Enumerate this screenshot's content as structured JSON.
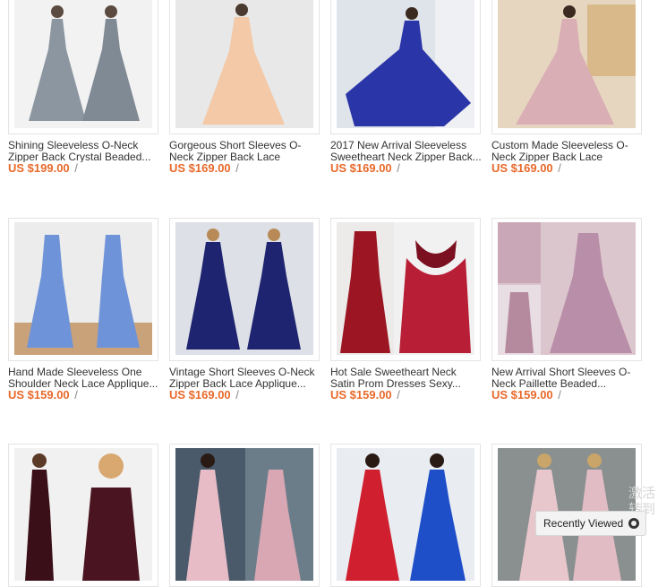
{
  "products": [
    {
      "title": "Shining Sleeveless O-Neck Zipper Back Crystal Beaded...",
      "price": "US $199.00",
      "slash": "/"
    },
    {
      "title": "Gorgeous Short Sleeves O-Neck Zipper Back Lace Applique...",
      "price": "US $169.00",
      "slash": "/"
    },
    {
      "title": "2017 New Arrival Sleeveless Sweetheart Neck Zipper Back...",
      "price": "US $169.00",
      "slash": "/"
    },
    {
      "title": "Custom Made Sleeveless O-Neck Zipper Back Lace Applique...",
      "price": "US $169.00",
      "slash": "/"
    },
    {
      "title": "Hand Made Sleeveless One Shoulder Neck Lace Applique...",
      "price": "US $159.00",
      "slash": "/"
    },
    {
      "title": "Vintage Short Sleeves O-Neck Zipper Back Lace Applique...",
      "price": "US $169.00",
      "slash": "/"
    },
    {
      "title": "Hot Sale Sweetheart Neck Satin Prom Dresses Sexy...",
      "price": "US $159.00",
      "slash": "/"
    },
    {
      "title": "New Arrival Short Sleeves O-Neck Paillette Beaded...",
      "price": "US $159.00",
      "slash": "/"
    }
  ],
  "recently_viewed": {
    "label": "Recently Viewed"
  },
  "watermark": {
    "text": "激活\n转到"
  },
  "colors": {
    "price": "#e8692b",
    "title": "#333333",
    "border": "#e4e4e4"
  }
}
